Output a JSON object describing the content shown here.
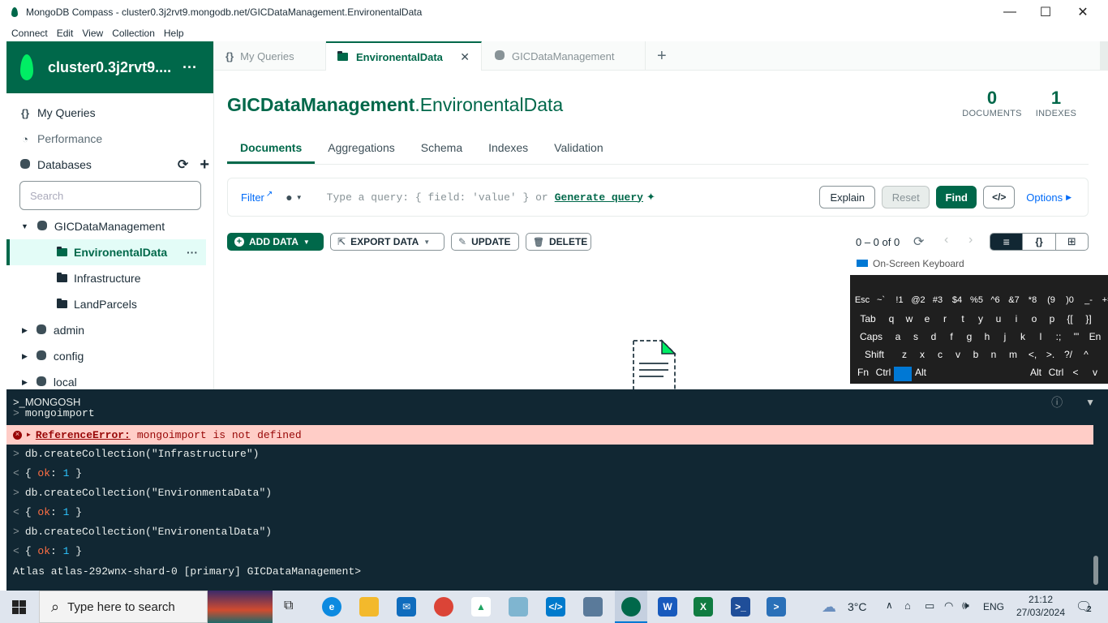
{
  "window": {
    "title": "MongoDB Compass - cluster0.3j2rvt9.mongodb.net/GICDataManagement.EnvironentalData",
    "minimize": "—",
    "maximize": "☐",
    "close": "✕"
  },
  "menu": [
    "Connect",
    "Edit",
    "View",
    "Collection",
    "Help"
  ],
  "sidebar": {
    "cluster_name": "cluster0.3j2rvt9....",
    "cluster_menu": "···",
    "my_queries": "My Queries",
    "performance": "Performance",
    "databases": "Databases",
    "search_placeholder": "Search",
    "databases_tree": [
      {
        "name": "GICDataManagement",
        "expanded": true,
        "collections": [
          "EnvironentalData",
          "Infrastructure",
          "LandParcels"
        ],
        "active": "EnvironentalData"
      },
      {
        "name": "admin"
      },
      {
        "name": "config"
      },
      {
        "name": "local"
      }
    ]
  },
  "tabs": [
    {
      "label": "My Queries",
      "icon": "{}"
    },
    {
      "label": "EnvironentalData",
      "active": true
    },
    {
      "label": "GICDataManagement"
    }
  ],
  "namespace": {
    "db": "GICDataManagement",
    "sep": ".",
    "collection": "EnvironentalData"
  },
  "stats": {
    "documents": "0",
    "documents_label": "DOCUMENTS",
    "indexes": "1",
    "indexes_label": "INDEXES"
  },
  "subtabs": [
    "Documents",
    "Aggregations",
    "Schema",
    "Indexes",
    "Validation"
  ],
  "querybar": {
    "filter_label": "Filter",
    "placeholder": "Type a query: { field: 'value' } or",
    "generate": "Generate query",
    "explain": "Explain",
    "reset": "Reset",
    "find": "Find",
    "code": "</>",
    "options": "Options"
  },
  "toolbar": {
    "add_data": "ADD DATA",
    "export_data": "EXPORT DATA",
    "update": "UPDATE",
    "delete": "DELETE",
    "pagination": "0 – 0 of 0"
  },
  "osk": {
    "title": "On-Screen Keyboard",
    "row1": [
      "Esc",
      "~`",
      "!1",
      "@2",
      "#3",
      "$4",
      "%5",
      "^6",
      "&7",
      "*8",
      "(9",
      ")0",
      "_-",
      "+="
    ],
    "row2": [
      "Tab",
      "q",
      "w",
      "e",
      "r",
      "t",
      "y",
      "u",
      "i",
      "o",
      "p",
      "{[",
      "}]"
    ],
    "row3": [
      "Caps",
      "a",
      "s",
      "d",
      "f",
      "g",
      "h",
      "j",
      "k",
      "l",
      ":;",
      "\"'",
      "En"
    ],
    "row4": [
      "Shift",
      "z",
      "x",
      "c",
      "v",
      "b",
      "n",
      "m",
      "<,",
      ">.",
      "?/",
      "^"
    ],
    "row5": [
      "Fn",
      "Ctrl",
      "",
      "Alt",
      "Alt",
      "Ctrl",
      "<",
      "v"
    ]
  },
  "shell": {
    "title": ">_MONGOSH",
    "prev_line": "mongoimport",
    "error_name": "ReferenceError:",
    "error_msg": "mongoimport is not defined",
    "lines": [
      {
        "type": "in",
        "text": "db.createCollection(\"Infrastructure\")"
      },
      {
        "type": "out"
      },
      {
        "type": "in",
        "text": "db.createCollection(\"EnvironmentaData\")"
      },
      {
        "type": "out"
      },
      {
        "type": "in",
        "text": "db.createCollection(\"EnvironentalData\")"
      },
      {
        "type": "out"
      }
    ],
    "ok_key": "ok",
    "ok_val": "1",
    "prompt": "Atlas atlas-292wnx-shard-0 [primary] GICDataManagement>"
  },
  "taskbar": {
    "search_placeholder": "Type here to search",
    "weather": "3°C",
    "language": "ENG",
    "time": "21:12",
    "date": "27/03/2024",
    "notifications": "2"
  }
}
